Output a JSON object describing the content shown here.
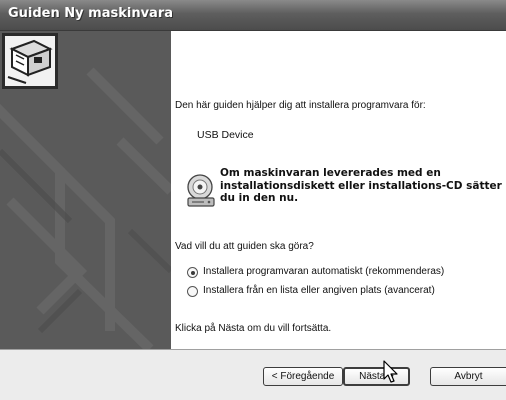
{
  "window": {
    "title": "Guiden Ny maskinvara"
  },
  "content": {
    "intro": "Den här guiden hjälper dig att installera programvara för:",
    "device_name": "USB Device",
    "cd_message_lines": [
      "Om maskinvaran levererades med en",
      "installationsdiskett eller installations-CD sätter",
      "du in den nu."
    ],
    "question": "Vad vill du att guiden ska göra?",
    "options": [
      {
        "label": "Installera programvaran automatiskt (rekommenderas)",
        "selected": true
      },
      {
        "label": "Installera från en lista eller angiven plats (avancerat)",
        "selected": false
      }
    ],
    "continue_hint": "Klicka på Nästa om du vill fortsätta."
  },
  "buttons": {
    "back": "< Föregående",
    "next": "Nästa >",
    "cancel": "Avbryt"
  },
  "icons": {
    "wizard": "hardware-board-icon",
    "cd": "cd-drive-icon",
    "cursor": "mouse-pointer-icon"
  }
}
